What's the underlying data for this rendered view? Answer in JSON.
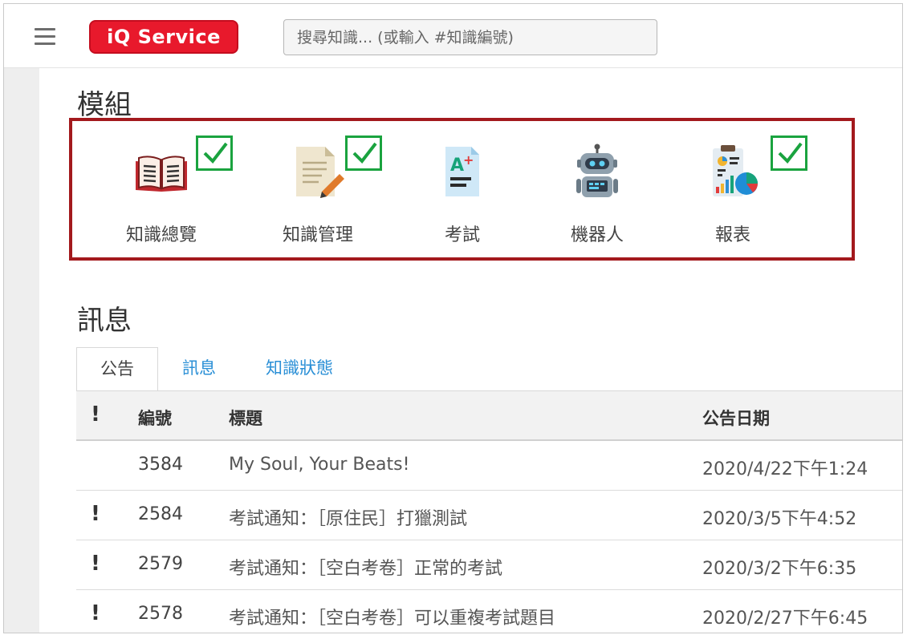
{
  "header": {
    "logo_text": "iQ Service",
    "search_placeholder": "搜尋知識... (或輸入 #知識編號)"
  },
  "modules": {
    "title": "模組",
    "items": [
      {
        "label": "知識總覽",
        "icon": "open-book-icon",
        "checked": true
      },
      {
        "label": "知識管理",
        "icon": "document-pencil-icon",
        "checked": true
      },
      {
        "label": "考試",
        "icon": "exam-grade-icon",
        "checked": false
      },
      {
        "label": "機器人",
        "icon": "robot-icon",
        "checked": false
      },
      {
        "label": "報表",
        "icon": "report-chart-icon",
        "checked": true
      }
    ]
  },
  "messages": {
    "title": "訊息",
    "tabs": [
      {
        "label": "公告",
        "active": true
      },
      {
        "label": "訊息",
        "active": false
      },
      {
        "label": "知識狀態",
        "active": false
      }
    ],
    "columns": {
      "flag": "!",
      "id": "編號",
      "title": "標題",
      "date": "公告日期"
    },
    "rows": [
      {
        "flag": "",
        "id": "3584",
        "title": "My Soul, Your Beats!",
        "date": "2020/4/22下午1:24"
      },
      {
        "flag": "!",
        "id": "2584",
        "title": "考試通知：［原住民］打獵測試",
        "date": "2020/3/5下午4:52"
      },
      {
        "flag": "!",
        "id": "2579",
        "title": "考試通知：［空白考卷］正常的考試",
        "date": "2020/3/2下午6:35"
      },
      {
        "flag": "!",
        "id": "2578",
        "title": "考試通知：［空白考卷］可以重複考試題目",
        "date": "2020/2/27下午6:45"
      }
    ]
  },
  "colors": {
    "brand_red": "#e8192c",
    "highlight_border": "#a3191d",
    "check_green": "#1aa33f",
    "link_blue": "#2a8fd6"
  }
}
